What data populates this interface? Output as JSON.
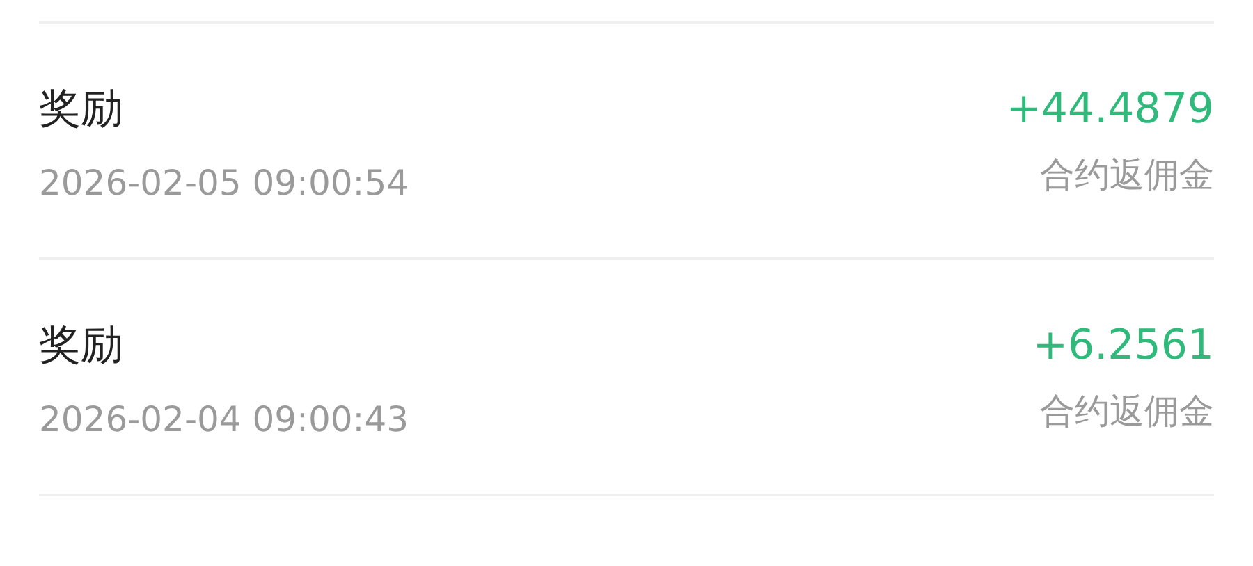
{
  "records": [
    {
      "title": "奖励",
      "time": "2026-02-05 09:00:54",
      "amount": "+44.4879",
      "note": "合约返佣金"
    },
    {
      "title": "奖励",
      "time": "2026-02-04 09:00:43",
      "amount": "+6.2561",
      "note": "合约返佣金"
    }
  ]
}
